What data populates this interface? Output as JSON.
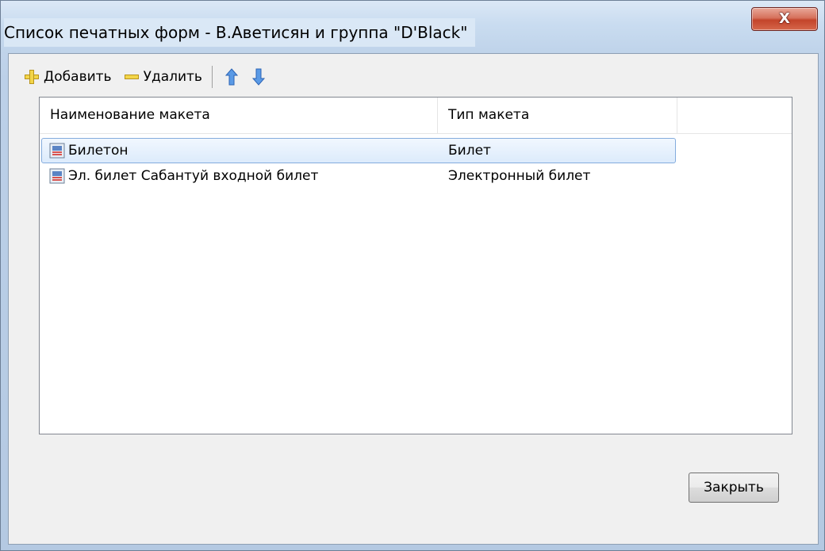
{
  "window": {
    "title": "Список печатных форм -  В.Аветисян и группа \"D'Black\"",
    "close_glyph": "X"
  },
  "toolbar": {
    "add_label": "Добавить",
    "delete_label": "Удалить"
  },
  "list": {
    "columns": [
      "Наименование макета",
      "Тип макета"
    ],
    "rows": [
      {
        "name": "Билетон",
        "type": "Билет",
        "selected": true
      },
      {
        "name": "Эл. билет Сабантуй входной билет",
        "type": "Электронный билет",
        "selected": false
      }
    ]
  },
  "footer": {
    "close_label": "Закрыть"
  },
  "colors": {
    "selection_border": "#84acdd",
    "icon_yellow": "#f3d549",
    "arrow_blue": "#3d7fd8",
    "close_red": "#c3442a"
  }
}
